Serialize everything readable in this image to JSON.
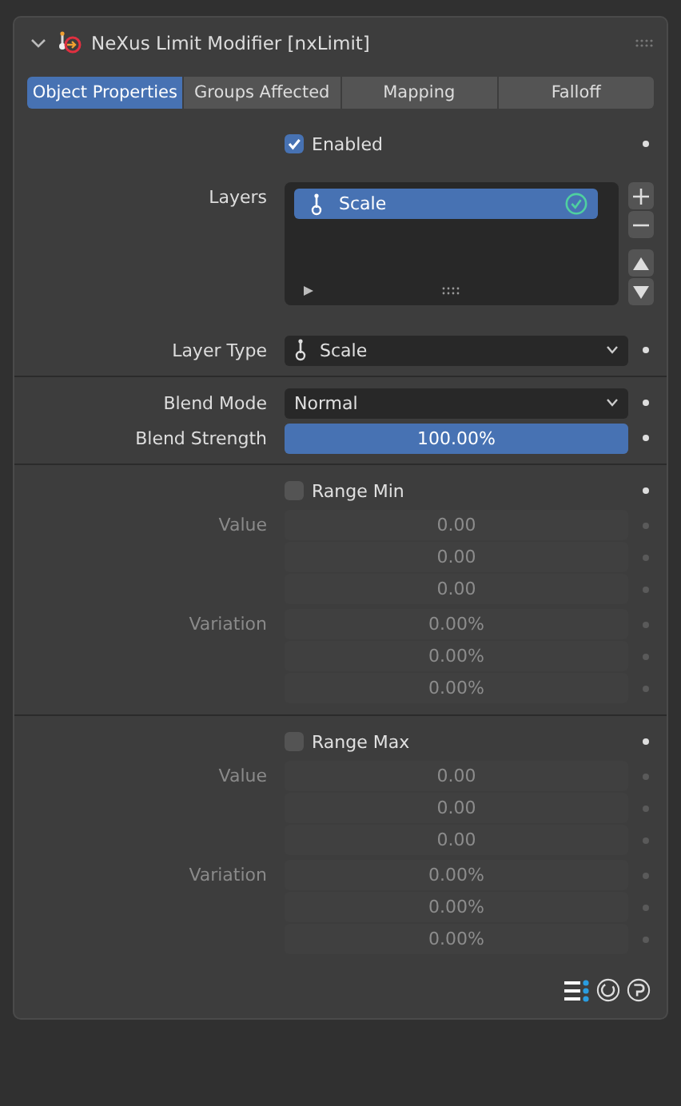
{
  "panel": {
    "title": "NeXus Limit Modifier [nxLimit]",
    "expanded": true
  },
  "tabs": [
    {
      "label": "Object Properties",
      "selected": true
    },
    {
      "label": "Groups Affected",
      "selected": false
    },
    {
      "label": "Mapping",
      "selected": false
    },
    {
      "label": "Falloff",
      "selected": false
    }
  ],
  "enabled": {
    "label": "Enabled",
    "checked": true
  },
  "layers": {
    "label": "Layers",
    "items": [
      {
        "name": "Scale",
        "selected": true,
        "active": true
      }
    ]
  },
  "layer_type": {
    "label": "Layer Type",
    "value": "Scale"
  },
  "blend_mode": {
    "label": "Blend Mode",
    "value": "Normal"
  },
  "blend_strength": {
    "label": "Blend Strength",
    "level": 1.0,
    "reading": "100.00%"
  },
  "ranges": [
    {
      "label": "Range Min",
      "checked": false,
      "value_label": "Value",
      "values": [
        "0.00",
        "0.00",
        "0.00"
      ],
      "variation_label": "Variation",
      "variations": [
        "0.00%",
        "0.00%",
        "0.00%"
      ]
    },
    {
      "label": "Range Max",
      "checked": false,
      "value_label": "Value",
      "values": [
        "0.00",
        "0.00",
        "0.00"
      ],
      "variation_label": "Variation",
      "variations": [
        "0.00%",
        "0.00%",
        "0.00%"
      ]
    }
  ]
}
